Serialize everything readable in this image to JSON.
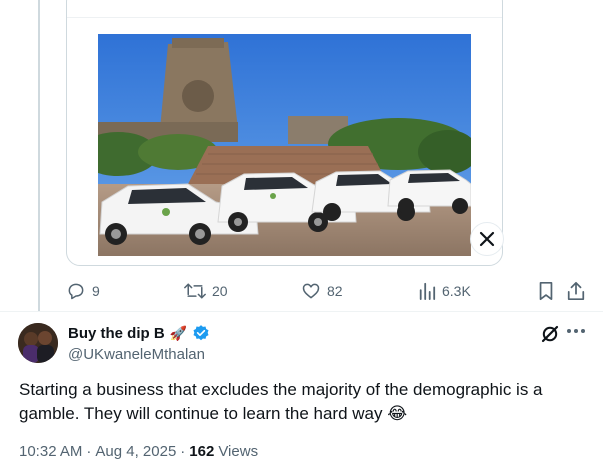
{
  "quoted_media": {
    "description_icon": "photo-of-white-suvs-in-front-of-monument"
  },
  "actions": {
    "replies": "9",
    "reposts": "20",
    "likes": "82",
    "views": "6.3K"
  },
  "reply": {
    "display_name": "Buy the dip B",
    "emoji": "🚀",
    "handle": "@UKwaneleMthalan",
    "text": "Starting a business that excludes the majority of the demographic is a gamble. They will continue to learn the hard way 😂",
    "time": "10:32 AM",
    "dot": "·",
    "date": "Aug 4, 2025",
    "views_count": "162",
    "views_label": "Views"
  },
  "colors": {
    "verified": "#1d9bf0",
    "muted": "#536471",
    "text": "#0f1419"
  }
}
